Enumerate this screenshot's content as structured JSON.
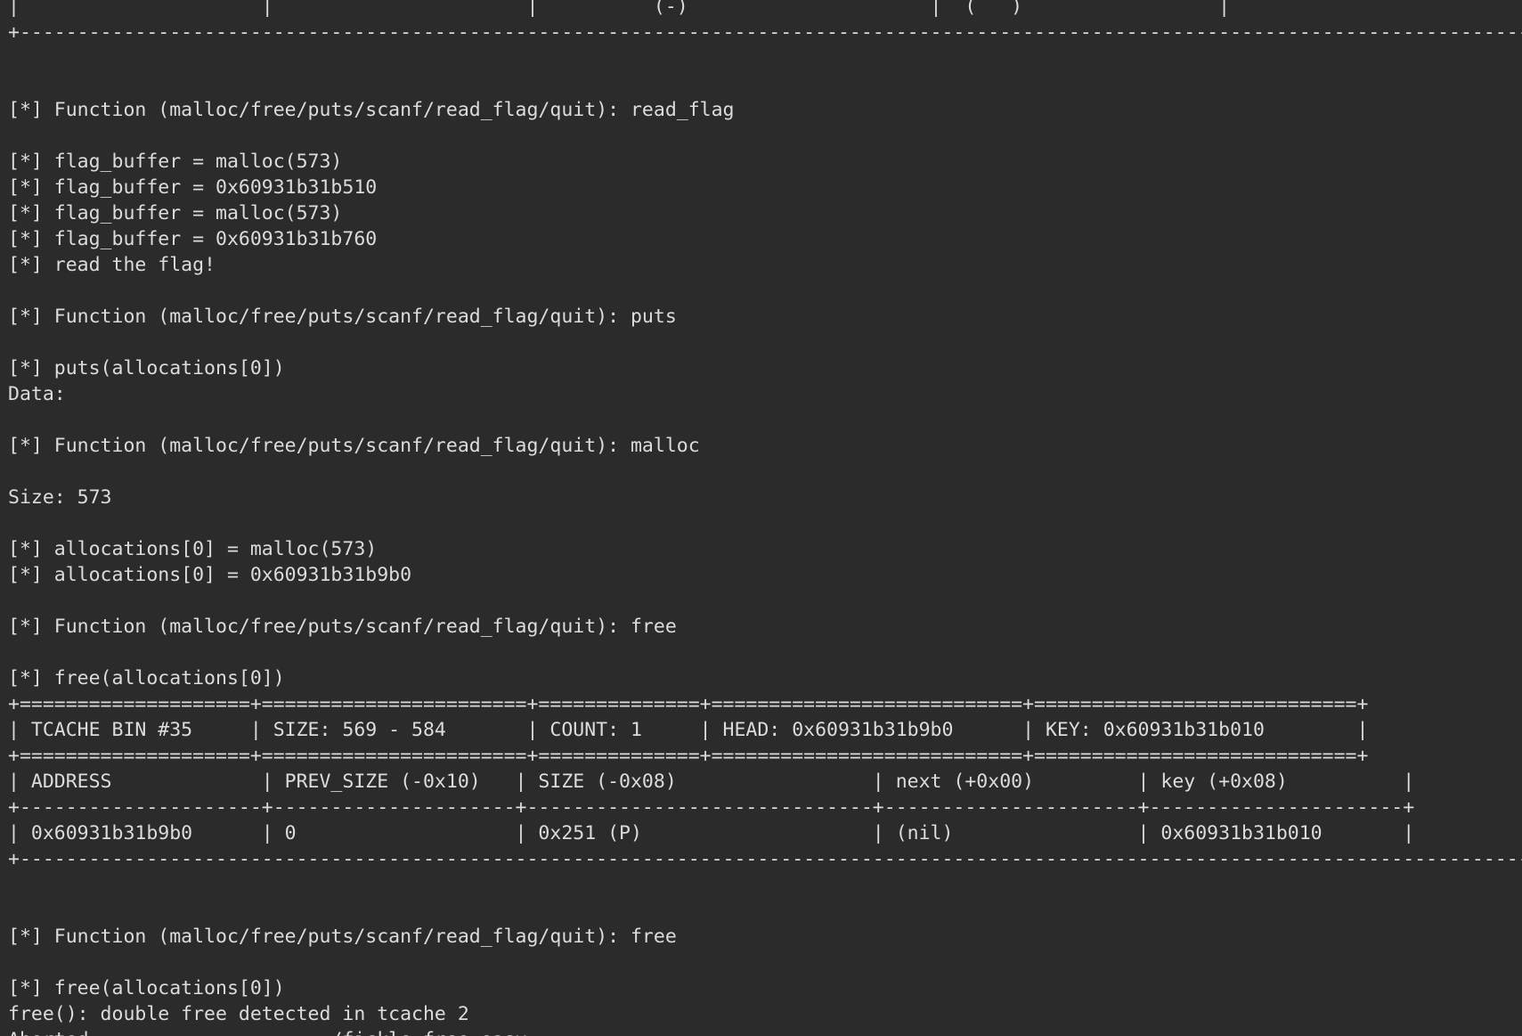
{
  "terminal": {
    "lines": [
      "|                     |                      |          (-)                     |  (   )                 |                            |",
      "+-----------------------------------------------------------------------------------------------------------------------------------+",
      "",
      "",
      "[*] Function (malloc/free/puts/scanf/read_flag/quit): read_flag",
      "",
      "[*] flag_buffer = malloc(573)",
      "[*] flag_buffer = 0x60931b31b510",
      "[*] flag_buffer = malloc(573)",
      "[*] flag_buffer = 0x60931b31b760",
      "[*] read the flag!",
      "",
      "[*] Function (malloc/free/puts/scanf/read_flag/quit): puts",
      "",
      "[*] puts(allocations[0])",
      "Data:",
      "",
      "[*] Function (malloc/free/puts/scanf/read_flag/quit): malloc",
      "",
      "Size: 573",
      "",
      "[*] allocations[0] = malloc(573)",
      "[*] allocations[0] = 0x60931b31b9b0",
      "",
      "[*] Function (malloc/free/puts/scanf/read_flag/quit): free",
      "",
      "[*] free(allocations[0])",
      "+====================+=======================+==============+===========================+============================+",
      "| TCACHE BIN #35     | SIZE: 569 - 584       | COUNT: 1     | HEAD: 0x60931b31b9b0      | KEY: 0x60931b31b010        |",
      "+====================+=======================+==============+===========================+============================+",
      "| ADDRESS             | PREV_SIZE (-0x10)   | SIZE (-0x08)                 | next (+0x00)         | key (+0x08)          |",
      "+---------------------+---------------------+------------------------------+----------------------+----------------------+",
      "| 0x60931b31b9b0      | 0                   | 0x251 (P)                    | (nil)                | 0x60931b31b010       |",
      "+-----------------------------------------------------------------------------------------------------------------------------------+",
      "",
      "",
      "[*] Function (malloc/free/puts/scanf/read_flag/quit): free",
      "",
      "[*] free(allocations[0])",
      "free(): double free detected in tcache 2",
      "Aborted                    ./fickle-free-easy"
    ]
  }
}
